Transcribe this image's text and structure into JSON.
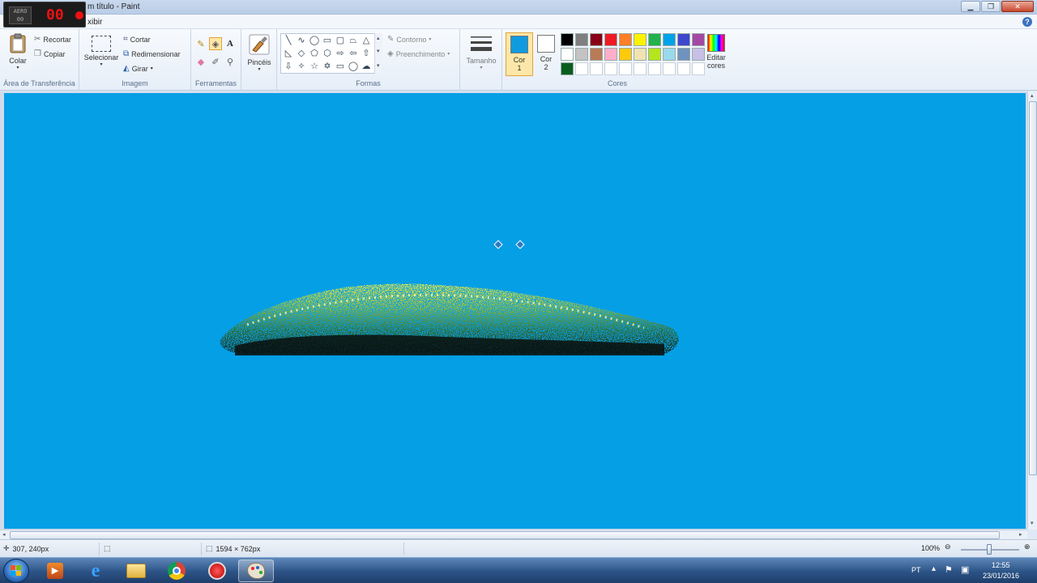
{
  "window": {
    "title": "Sem título - Paint",
    "title_visible": "m título - Paint",
    "minimize": "▁",
    "restore": "❐",
    "close": "✕"
  },
  "recorder": {
    "label": "AERO\n00",
    "digits": "00"
  },
  "menu": {
    "view": "Exibir",
    "view_visible": "xibir",
    "help": "?"
  },
  "ribbon": {
    "clipboard": {
      "label": "Área de Transferência",
      "paste": "Colar",
      "cut": "Recortar",
      "copy": "Copiar"
    },
    "image": {
      "label": "Imagem",
      "select": "Selecionar",
      "crop": "Cortar",
      "resize": "Redimensionar",
      "rotate": "Girar"
    },
    "tools": {
      "label": "Ferramentas"
    },
    "brushes": {
      "label": "Pincéis"
    },
    "shapes": {
      "label": "Formas",
      "outline": "Contorno",
      "fill": "Preenchimento"
    },
    "size": {
      "label": "Tamanho"
    },
    "colors": {
      "label": "Cores",
      "color1": "Cor 1",
      "color1_line1": "Cor",
      "color1_line2": "1",
      "color2_line1": "Cor",
      "color2_line2": "2",
      "edit_line1": "Editar",
      "edit_line2": "cores",
      "color1_value": "#0f9be0",
      "color2_value": "#ffffff",
      "palette": [
        "#000000",
        "#7f7f7f",
        "#880015",
        "#ed1c24",
        "#ff7f27",
        "#fff200",
        "#22b14c",
        "#00a2e8",
        "#3f48cc",
        "#a349a4",
        "#ffffff",
        "#c3c3c3",
        "#b97a57",
        "#ffaec9",
        "#ffc90e",
        "#efe4b0",
        "#b5e61d",
        "#99d9ea",
        "#7092be",
        "#c8bfe7",
        "#0b5d1e",
        "#ffffff",
        "#ffffff",
        "#ffffff",
        "#ffffff",
        "#ffffff",
        "#ffffff",
        "#ffffff",
        "#ffffff",
        "#ffffff"
      ]
    }
  },
  "canvas": {
    "background": "#059fe6"
  },
  "status": {
    "cursor_pos": "307, 240px",
    "image_size": "1594 × 762px",
    "zoom": "100%"
  },
  "taskbar": {
    "lang": "PT",
    "time": "12:55",
    "date": "23/01/2016"
  }
}
